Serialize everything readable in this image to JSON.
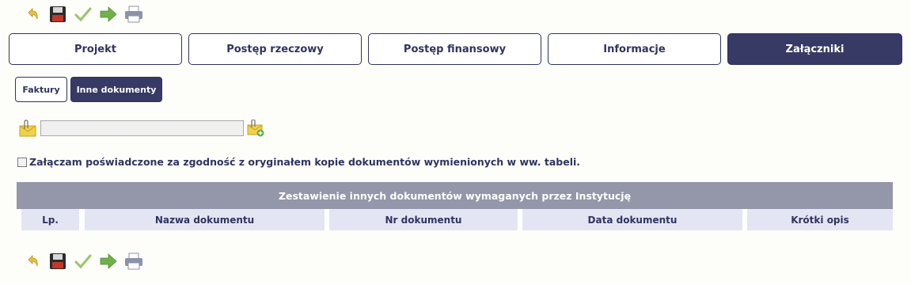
{
  "toolbar": {
    "items": [
      {
        "name": "undo-icon",
        "color": "#e8c23a"
      },
      {
        "name": "save-icon",
        "color": "#2b2b2b"
      },
      {
        "name": "checkmark-icon",
        "color": "#9bc46f"
      },
      {
        "name": "forward-arrow-icon",
        "color": "#6fb24a"
      },
      {
        "name": "print-icon",
        "color": "#8a93a8"
      }
    ]
  },
  "tabs": [
    {
      "label": "Projekt",
      "active": false
    },
    {
      "label": "Postęp rzeczowy",
      "active": false
    },
    {
      "label": "Postęp finansowy",
      "active": false
    },
    {
      "label": "Informacje",
      "active": false
    },
    {
      "label": "Załączniki",
      "active": true
    }
  ],
  "subtabs": [
    {
      "label": "Faktury",
      "active": false
    },
    {
      "label": "Inne dokumenty",
      "active": true
    }
  ],
  "attachment": {
    "value": "",
    "attach_icon": "paperclip-envelope-icon",
    "add_icon": "add-envelope-icon"
  },
  "confirmation": {
    "checked": false,
    "label": "Załączam poświadczone za zgodność z oryginałem kopie dokumentów wymienionych w ww. tabeli."
  },
  "documents_table": {
    "title": "Zestawienie innych dokumentów wymaganych przez Instytucję",
    "columns": [
      "Lp.",
      "Nazwa dokumentu",
      "Nr dokumentu",
      "Data dokumentu",
      "Krótki opis"
    ],
    "rows": []
  },
  "colors": {
    "accent": "#363a64",
    "table_header": "#9496aa",
    "column_header": "#e4e5f3",
    "background": "#fdfdf9"
  }
}
